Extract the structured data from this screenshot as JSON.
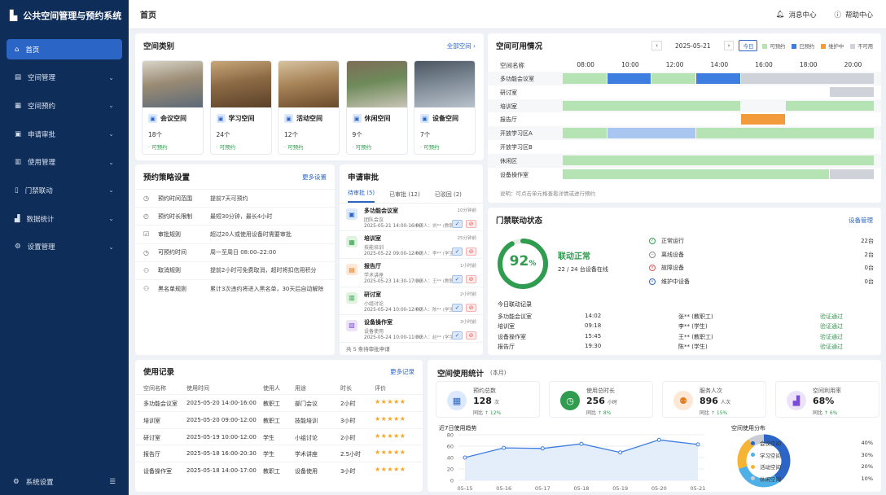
{
  "app": {
    "title": "公共空间管理与预约系统"
  },
  "sidebar": {
    "items": [
      {
        "label": "首页",
        "icon": "home-icon",
        "active": true
      },
      {
        "label": "空间管理",
        "icon": "building-icon"
      },
      {
        "label": "空间预约",
        "icon": "calendar-icon"
      },
      {
        "label": "申请审批",
        "icon": "approval-icon"
      },
      {
        "label": "使用管理",
        "icon": "list-icon"
      },
      {
        "label": "门禁联动",
        "icon": "door-icon"
      },
      {
        "label": "数据统计",
        "icon": "chart-icon"
      },
      {
        "label": "设置管理",
        "icon": "gear-icon"
      }
    ],
    "bottom_label": "系统设置"
  },
  "header": {
    "title": "首页",
    "messages": "消息中心",
    "help": "帮助中心"
  },
  "space_types": {
    "title": "空间类别",
    "all_link": "全部空间",
    "items": [
      {
        "name": "会议空间",
        "count": "18个",
        "status": "· 可预约",
        "img": [
          "#9a8b74",
          "#5c6a78",
          "#d9d4c8"
        ]
      },
      {
        "name": "学习空间",
        "count": "24个",
        "status": "· 可预约",
        "img": [
          "#8c6a45",
          "#5b4129",
          "#c9a77a"
        ]
      },
      {
        "name": "活动空间",
        "count": "12个",
        "status": "· 可预约",
        "img": [
          "#a88458",
          "#6a4a2c",
          "#d6c2a0"
        ]
      },
      {
        "name": "休闲空间",
        "count": "9个",
        "status": "· 可预约",
        "img": [
          "#6e8a5a",
          "#c9c4b6",
          "#7e6c58"
        ]
      },
      {
        "name": "设备空间",
        "count": "7个",
        "status": "· 可预约",
        "img": [
          "#7c8894",
          "#b9c2cb",
          "#4a5560"
        ]
      }
    ]
  },
  "availability": {
    "title": "空间可用情况",
    "date": "2025-05-21",
    "today": "今日",
    "legend": [
      {
        "label": "可预约",
        "color": "#b6e3b4"
      },
      {
        "label": "已预约",
        "color": "#3d7ee0"
      },
      {
        "label": "维护中",
        "color": "#f39a3c"
      },
      {
        "label": "不可用",
        "color": "#cfd2d8"
      }
    ],
    "col_header": "空间名称",
    "times": [
      "08:00",
      "10:00",
      "12:00",
      "14:00",
      "16:00",
      "18:00",
      "20:00"
    ],
    "rows": [
      {
        "name": "多功能会议室",
        "segs": [
          [
            8,
            10,
            "g"
          ],
          [
            10,
            12,
            "b"
          ],
          [
            12,
            14,
            "g"
          ],
          [
            14,
            16,
            "b"
          ],
          [
            16,
            22,
            "x"
          ]
        ]
      },
      {
        "name": "研讨室",
        "segs": [
          [
            20,
            22,
            "x"
          ]
        ]
      },
      {
        "name": "培训室",
        "segs": [
          [
            8,
            16,
            "g"
          ],
          [
            18,
            22,
            "g"
          ]
        ]
      },
      {
        "name": "报告厅",
        "segs": [
          [
            16,
            18,
            "o"
          ]
        ]
      },
      {
        "name": "开放学习区A",
        "segs": [
          [
            8,
            10,
            "g"
          ],
          [
            10,
            14,
            "lb"
          ],
          [
            14,
            22,
            "g"
          ]
        ]
      },
      {
        "name": "开放学习区B",
        "segs": []
      },
      {
        "name": "休闲区",
        "segs": [
          [
            8,
            22,
            "g"
          ]
        ]
      },
      {
        "name": "设备操作室",
        "segs": [
          [
            8,
            20,
            "g"
          ],
          [
            20,
            22,
            "x"
          ]
        ]
      }
    ],
    "note": "说明：可点击单元格查看详情或进行预约"
  },
  "policy": {
    "title": "预约策略设置",
    "link": "更多设置",
    "rows": [
      {
        "icon": "clock-icon",
        "glyph": "◷",
        "name": "预约时间范围",
        "value": "提前7天可预约"
      },
      {
        "icon": "timer-icon",
        "glyph": "◴",
        "name": "预约时长限制",
        "value": "最短30分钟，最长4小时"
      },
      {
        "icon": "approval-icon",
        "glyph": "☑",
        "name": "审批规则",
        "value": "超过20人或使用设备时需要审批"
      },
      {
        "icon": "clock-icon",
        "glyph": "◷",
        "name": "可预约时间",
        "value": "周一至周日 08:00–22:00"
      },
      {
        "icon": "user-cancel-icon",
        "glyph": "⚇",
        "name": "取消规则",
        "value": "提前2小时可免费取消，超时将扣信用积分"
      },
      {
        "icon": "user-block-icon",
        "glyph": "⚇",
        "name": "黑名单规则",
        "value": "累计3次违约将进入黑名单，30天后自动解除"
      }
    ]
  },
  "approval": {
    "title": "申请审批",
    "tabs": [
      "待审批 (5)",
      "已审批 (12)",
      "已驳回 (2)"
    ],
    "items": [
      {
        "name": "多功能会议室",
        "sub": "团队会议",
        "date": "2025-05-21 14:00-16:00",
        "time": "10分钟前",
        "who": "申请人：刘** (教职工)",
        "glyph": "▣",
        "bg": "#dce8fb",
        "fg": "#2b65c5"
      },
      {
        "name": "培训室",
        "sub": "技能培训",
        "date": "2025-05-22 09:00-12:00",
        "time": "25分钟前",
        "who": "申请人：李** (学生)",
        "glyph": "▦",
        "bg": "#dff3df",
        "fg": "#2f9c4f"
      },
      {
        "name": "报告厅",
        "sub": "学术讲座",
        "date": "2025-05-23 14:30-17:30",
        "time": "1小时前",
        "who": "申请人：王** (教职工)",
        "glyph": "▤",
        "bg": "#fde8d6",
        "fg": "#e07b21"
      },
      {
        "name": "研讨室",
        "sub": "小组讨论",
        "date": "2025-05-24 10:00-12:00",
        "time": "2小时前",
        "who": "申请人：陈** (学生)",
        "glyph": "▥",
        "bg": "#dff3df",
        "fg": "#2f9c4f"
      },
      {
        "name": "设备操作室",
        "sub": "设备使用",
        "date": "2025-05-24 10:00-11:30",
        "time": "3小时前",
        "who": "申请人：赵** (学生)",
        "glyph": "▧",
        "bg": "#ece3fb",
        "fg": "#7a4bd6"
      }
    ],
    "footer": "共 5 条待审批申请"
  },
  "door": {
    "title": "门禁联动状态",
    "link": "设备管理",
    "percent": "92",
    "percent_value": 0.92,
    "status": "联动正常",
    "online": "22 / 24 台设备在线",
    "devices": [
      {
        "label": "正常运行",
        "count": "22台",
        "color": "#2f9c4f",
        "glyph": "✓"
      },
      {
        "label": "离线设备",
        "count": "2台",
        "color": "#888",
        "glyph": "−"
      },
      {
        "label": "故障设备",
        "count": "0台",
        "color": "#e15353",
        "glyph": "×"
      },
      {
        "label": "维护中设备",
        "count": "0台",
        "color": "#2b65c5",
        "glyph": "•"
      }
    ],
    "today_title": "今日联动记录",
    "records": [
      {
        "space": "多功能会议室",
        "time": "14:02",
        "user": "张** (教职工)",
        "result": "验证通过"
      },
      {
        "space": "培训室",
        "time": "09:18",
        "user": "李** (学生)",
        "result": "验证通过"
      },
      {
        "space": "设备操作室",
        "time": "15:45",
        "user": "王** (教职工)",
        "result": "验证通过"
      },
      {
        "space": "报告厅",
        "time": "19:30",
        "user": "陈** (学生)",
        "result": "验证通过"
      }
    ]
  },
  "usage": {
    "title": "使用记录",
    "link": "更多记录",
    "headers": [
      "空间名称",
      "使用时间",
      "使用人",
      "用途",
      "时长",
      "评价"
    ],
    "rows": [
      [
        "多功能会议室",
        "2025-05-20 14:00-16:00",
        "教职工",
        "部门会议",
        "2小时",
        "★★★★★"
      ],
      [
        "培训室",
        "2025-05-20 09:00-12:00",
        "教职工",
        "技能培训",
        "3小时",
        "★★★★★"
      ],
      [
        "研讨室",
        "2025-05-19 10:00-12:00",
        "学生",
        "小组讨论",
        "2小时",
        "★★★★★"
      ],
      [
        "报告厅",
        "2025-05-18 16:00-20:30",
        "学生",
        "学术讲座",
        "2.5小时",
        "★★★★★"
      ],
      [
        "设备操作室",
        "2025-05-18 14:00-17:00",
        "教职工",
        "设备使用",
        "3小时",
        "★★★★★"
      ]
    ]
  },
  "stats": {
    "title": "空间使用统计",
    "period": "(本月)",
    "cards": [
      {
        "label": "预约总数",
        "value": "128",
        "unit": "次",
        "cmp": "同比",
        "delta": "↑ 12%",
        "icon": "calendar-icon",
        "glyph": "▦",
        "bg": "#dce8fb",
        "fg": "#2b65c5"
      },
      {
        "label": "使用总时长",
        "value": "256",
        "unit": "小时",
        "cmp": "同比",
        "delta": "↑ 8%",
        "icon": "clock-icon",
        "glyph": "◷",
        "bg": "#2f9c4f",
        "fg": "#fff"
      },
      {
        "label": "服务人次",
        "value": "896",
        "unit": "人次",
        "cmp": "同比",
        "delta": "↑ 15%",
        "icon": "users-icon",
        "glyph": "⚉",
        "bg": "#fde8d6",
        "fg": "#e07b21"
      },
      {
        "label": "空间利用率",
        "value": "68%",
        "unit": "",
        "cmp": "同比",
        "delta": "↑ 6%",
        "icon": "bar-chart-icon",
        "glyph": "▟",
        "bg": "#ece3fb",
        "fg": "#7a4bd6"
      }
    ]
  },
  "chart_data": [
    {
      "type": "line",
      "title": "近7日使用趋势",
      "x": [
        "05-15",
        "05-16",
        "05-17",
        "05-18",
        "05-19",
        "05-20",
        "05-21"
      ],
      "series": [
        {
          "values": [
            40,
            57,
            56,
            64,
            49,
            71,
            63
          ]
        }
      ],
      "ylim": [
        0,
        80
      ],
      "yticks": [
        0,
        20,
        40,
        60,
        80
      ],
      "grid": true
    },
    {
      "type": "pie",
      "title": "空间使用分布",
      "labels": [
        "会议空间",
        "学习空间",
        "活动空间",
        "休闲空间"
      ],
      "values": [
        40,
        30,
        20,
        10
      ],
      "percent_labels": [
        "40%",
        "30%",
        "20%",
        "10%"
      ],
      "colors": [
        "#2b65c5",
        "#4fb0e8",
        "#f5b433",
        "#c9ccd3"
      ],
      "legend": "right"
    }
  ]
}
